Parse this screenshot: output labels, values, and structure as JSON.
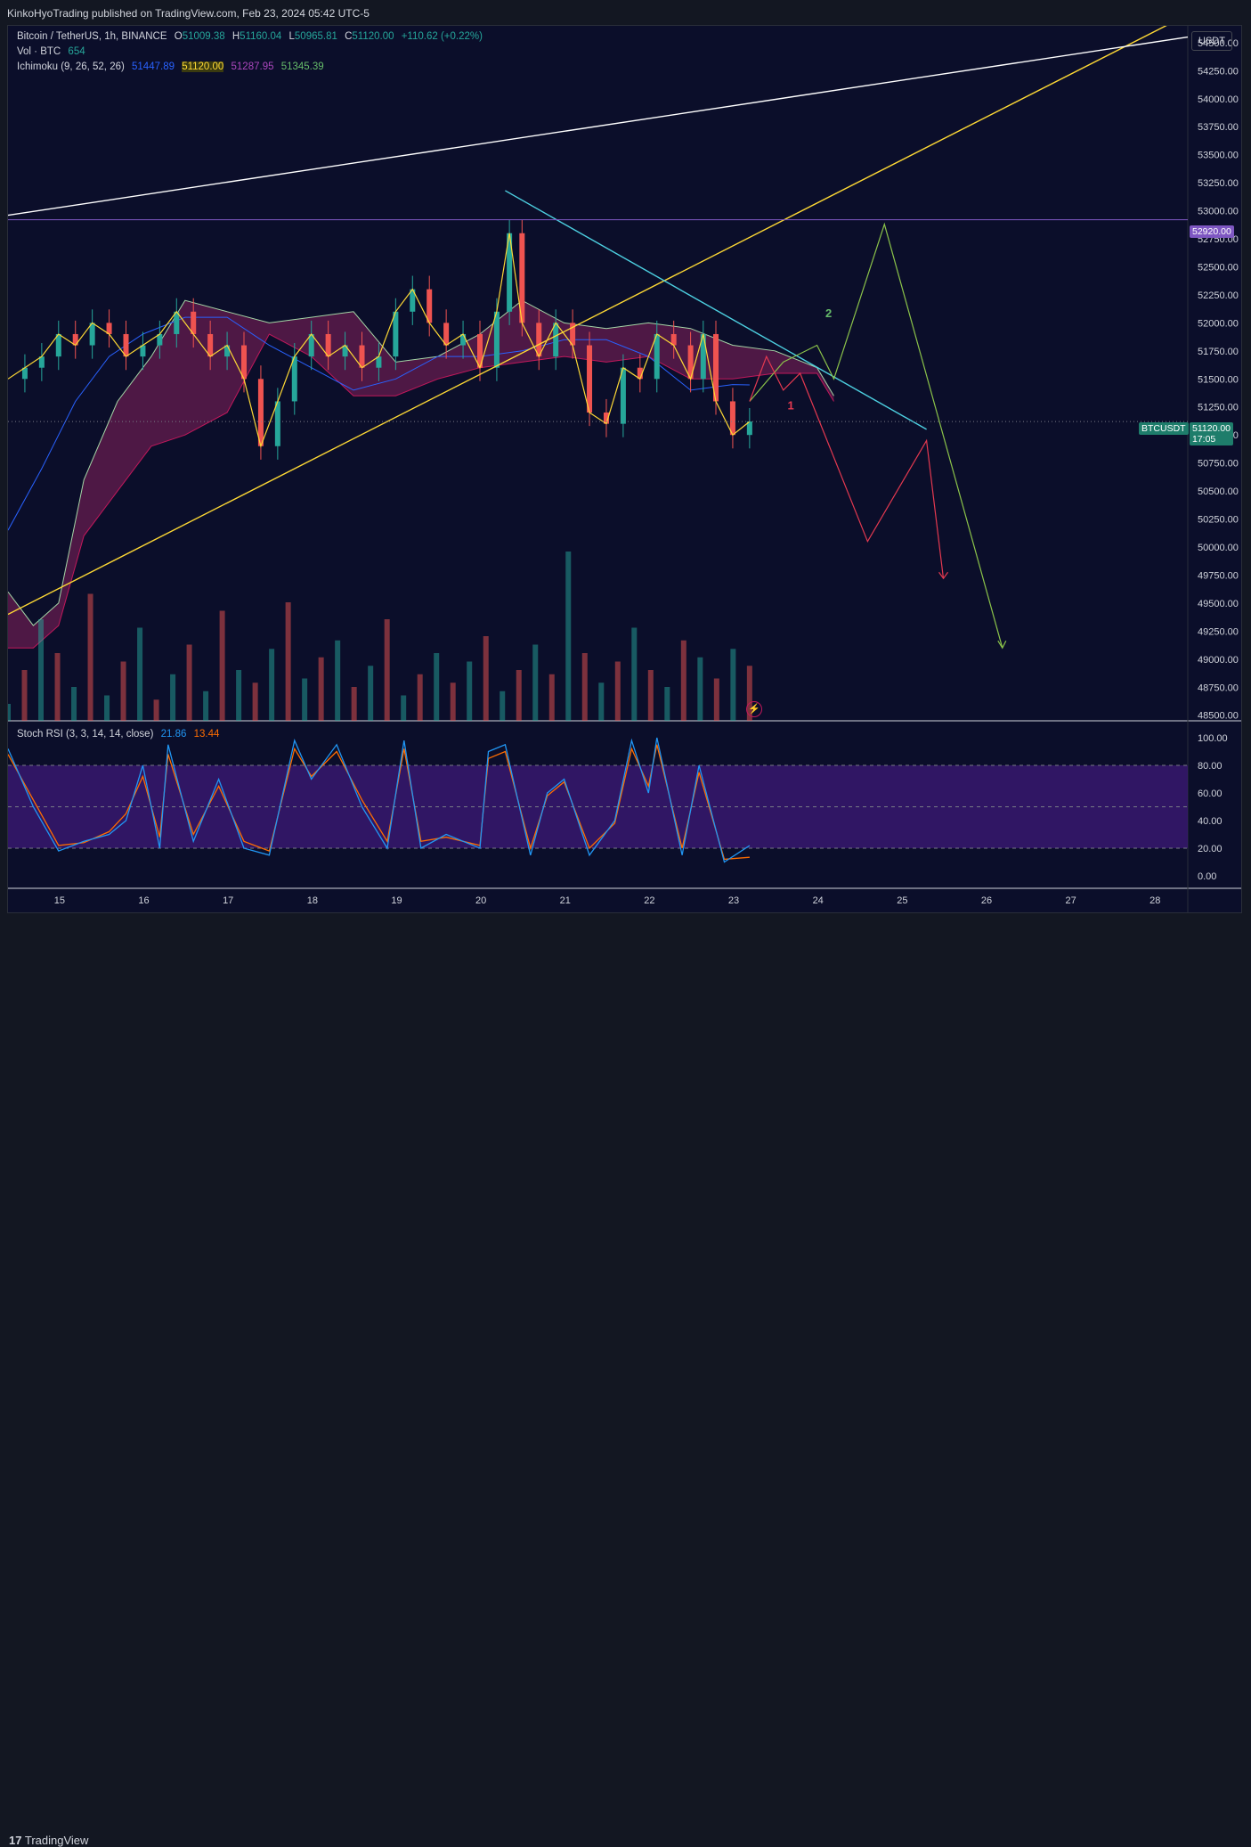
{
  "header": {
    "publisher": "KinkoHyoTrading published on TradingView.com, Feb 23, 2024 05:42 UTC-5"
  },
  "legend": {
    "symbol": "Bitcoin / TetherUS, 1h, BINANCE",
    "open_label": "O",
    "open": "51009.38",
    "high_label": "H",
    "high": "51160.04",
    "low_label": "L",
    "low": "50965.81",
    "close_label": "C",
    "close": "51120.00",
    "change": "+110.62 (+0.22%)",
    "vol_label": "Vol · BTC",
    "vol_value": "654",
    "ichimoku_label": "Ichimoku (9, 26, 52, 26)",
    "ichimoku_values": [
      "51447.89",
      "51120.00",
      "51287.95",
      "51345.39"
    ],
    "stoch_label": "Stoch RSI (3, 3, 14, 14, close)",
    "stoch_k": "21.86",
    "stoch_d": "13.44"
  },
  "price_axis": {
    "currency": "USDT",
    "ticks": [
      "54500.00",
      "54250.00",
      "54000.00",
      "53750.00",
      "53500.00",
      "53250.00",
      "53000.00",
      "52750.00",
      "52500.00",
      "52250.00",
      "52000.00",
      "51750.00",
      "51500.00",
      "51250.00",
      "51000.00",
      "50750.00",
      "50500.00",
      "50250.00",
      "50000.00",
      "49750.00",
      "49500.00",
      "49250.00",
      "49000.00",
      "48750.00",
      "48500.00"
    ],
    "level_tag": "52920.00",
    "symbol_tag": "BTCUSDT",
    "price_tag": "51120.00",
    "countdown": "17:05"
  },
  "rsi_axis": {
    "ticks": [
      "100.00",
      "80.00",
      "60.00",
      "40.00",
      "20.00",
      "0.00"
    ]
  },
  "time_axis": {
    "ticks": [
      "15",
      "16",
      "17",
      "18",
      "19",
      "20",
      "21",
      "22",
      "23",
      "24",
      "25",
      "26",
      "27",
      "28"
    ]
  },
  "annotations": {
    "wave_1": "1",
    "wave_2": "2"
  },
  "footer": {
    "brand": "TradingView"
  },
  "colors": {
    "bull": "#26a69a",
    "bear": "#ef5350",
    "tenkan": "#fdd835",
    "kijun": "#2962ff",
    "cloud_bull": "#2e6b4f",
    "cloud_bear": "#5a1a4a",
    "trend": "#4dd0e1",
    "k": "#2196f3",
    "d": "#ff6d00"
  },
  "chart_data": {
    "type": "candlestick",
    "ylim": [
      48450,
      54650
    ],
    "xlim": [
      14.4,
      28.4
    ],
    "x_ticks": [
      15,
      16,
      17,
      18,
      19,
      20,
      21,
      22,
      23,
      24,
      25,
      26,
      27,
      28
    ],
    "close_series": [
      [
        14.4,
        51500
      ],
      [
        14.6,
        51600
      ],
      [
        14.8,
        51700
      ],
      [
        15.0,
        51900
      ],
      [
        15.2,
        51800
      ],
      [
        15.4,
        52000
      ],
      [
        15.6,
        51900
      ],
      [
        15.8,
        51700
      ],
      [
        16.0,
        51800
      ],
      [
        16.2,
        51900
      ],
      [
        16.4,
        52100
      ],
      [
        16.6,
        51900
      ],
      [
        16.8,
        51700
      ],
      [
        17.0,
        51800
      ],
      [
        17.2,
        51500
      ],
      [
        17.4,
        50900
      ],
      [
        17.6,
        51300
      ],
      [
        17.8,
        51700
      ],
      [
        18.0,
        51900
      ],
      [
        18.2,
        51700
      ],
      [
        18.4,
        51800
      ],
      [
        18.6,
        51600
      ],
      [
        18.8,
        51700
      ],
      [
        19.0,
        52100
      ],
      [
        19.2,
        52300
      ],
      [
        19.4,
        52000
      ],
      [
        19.6,
        51800
      ],
      [
        19.8,
        51900
      ],
      [
        20.0,
        51600
      ],
      [
        20.2,
        52100
      ],
      [
        20.35,
        52800
      ],
      [
        20.5,
        52000
      ],
      [
        20.7,
        51700
      ],
      [
        20.9,
        52000
      ],
      [
        21.1,
        51800
      ],
      [
        21.3,
        51200
      ],
      [
        21.5,
        51100
      ],
      [
        21.7,
        51600
      ],
      [
        21.9,
        51500
      ],
      [
        22.1,
        51900
      ],
      [
        22.3,
        51800
      ],
      [
        22.5,
        51500
      ],
      [
        22.65,
        51900
      ],
      [
        22.8,
        51300
      ],
      [
        23.0,
        51000
      ],
      [
        23.2,
        51120
      ]
    ],
    "ichimoku_cloud": {
      "upper": [
        [
          14.4,
          49600
        ],
        [
          14.7,
          49300
        ],
        [
          15.0,
          49500
        ],
        [
          15.3,
          50600
        ],
        [
          15.7,
          51300
        ],
        [
          16.1,
          51700
        ],
        [
          16.5,
          52200
        ],
        [
          17.0,
          52100
        ],
        [
          17.5,
          52000
        ],
        [
          18.0,
          52050
        ],
        [
          18.5,
          52100
        ],
        [
          19.0,
          51650
        ],
        [
          19.5,
          51700
        ],
        [
          20.0,
          51900
        ],
        [
          20.5,
          52200
        ],
        [
          21.0,
          52000
        ],
        [
          21.5,
          51950
        ],
        [
          22.0,
          52000
        ],
        [
          22.5,
          51950
        ],
        [
          23.0,
          51800
        ],
        [
          23.5,
          51750
        ],
        [
          24.0,
          51600
        ],
        [
          24.2,
          51350
        ]
      ],
      "lower": [
        [
          14.4,
          49100
        ],
        [
          14.7,
          49100
        ],
        [
          15.0,
          49300
        ],
        [
          15.3,
          50100
        ],
        [
          15.7,
          50500
        ],
        [
          16.1,
          50900
        ],
        [
          16.5,
          51000
        ],
        [
          17.0,
          51200
        ],
        [
          17.5,
          51900
        ],
        [
          18.0,
          51700
        ],
        [
          18.5,
          51350
        ],
        [
          19.0,
          51350
        ],
        [
          19.5,
          51500
        ],
        [
          20.0,
          51600
        ],
        [
          20.5,
          51650
        ],
        [
          21.0,
          51700
        ],
        [
          21.5,
          51650
        ],
        [
          22.0,
          51700
        ],
        [
          22.5,
          51500
        ],
        [
          23.0,
          51500
        ],
        [
          23.5,
          51550
        ],
        [
          24.0,
          51550
        ],
        [
          24.2,
          51300
        ]
      ]
    },
    "kijun_series": [
      [
        14.4,
        50150
      ],
      [
        14.8,
        50700
      ],
      [
        15.2,
        51300
      ],
      [
        15.6,
        51700
      ],
      [
        16.0,
        51900
      ],
      [
        16.5,
        52050
      ],
      [
        17.0,
        52050
      ],
      [
        17.5,
        51800
      ],
      [
        18.0,
        51600
      ],
      [
        18.5,
        51400
      ],
      [
        19.0,
        51500
      ],
      [
        19.5,
        51700
      ],
      [
        20.0,
        51700
      ],
      [
        20.5,
        51750
      ],
      [
        21.0,
        51850
      ],
      [
        21.5,
        51850
      ],
      [
        22.0,
        51700
      ],
      [
        22.5,
        51400
      ],
      [
        23.0,
        51450
      ],
      [
        23.2,
        51447
      ]
    ],
    "trend_lines": [
      {
        "from": [
          14.4,
          49400
        ],
        "to": [
          28.4,
          54750
        ],
        "color": "#fdd835"
      },
      {
        "from": [
          14.4,
          52960
        ],
        "to": [
          28.4,
          54550
        ],
        "color": "#ffffff"
      },
      {
        "from": [
          20.3,
          53180
        ],
        "to": [
          25.3,
          51050
        ],
        "color": "#4dd0e1"
      }
    ],
    "level_line": 52920,
    "projection_green": [
      [
        23.2,
        51300
      ],
      [
        23.6,
        51650
      ],
      [
        24.0,
        51800
      ],
      [
        24.2,
        51500
      ],
      [
        24.8,
        52880
      ],
      [
        26.2,
        49100
      ]
    ],
    "projection_red": [
      [
        23.2,
        51300
      ],
      [
        23.4,
        51700
      ],
      [
        23.6,
        51400
      ],
      [
        23.8,
        51550
      ],
      [
        24.6,
        50050
      ],
      [
        25.3,
        50950
      ],
      [
        25.5,
        49720
      ]
    ],
    "volume_values": [
      20,
      60,
      120,
      80,
      40,
      150,
      30,
      70,
      110,
      25,
      55,
      90,
      35,
      130,
      60,
      45,
      85,
      140,
      50,
      75,
      95,
      40,
      65,
      120,
      30,
      55,
      80,
      45,
      70,
      100,
      35,
      60,
      90,
      55,
      200,
      80,
      45,
      70,
      110,
      60,
      40,
      95,
      75,
      50,
      85,
      65
    ],
    "stoch_k": [
      [
        14.4,
        92
      ],
      [
        14.7,
        50
      ],
      [
        15.0,
        18
      ],
      [
        15.3,
        25
      ],
      [
        15.6,
        30
      ],
      [
        15.8,
        40
      ],
      [
        16.0,
        80
      ],
      [
        16.2,
        20
      ],
      [
        16.3,
        95
      ],
      [
        16.6,
        25
      ],
      [
        16.9,
        70
      ],
      [
        17.2,
        20
      ],
      [
        17.5,
        15
      ],
      [
        17.8,
        98
      ],
      [
        18.0,
        70
      ],
      [
        18.3,
        95
      ],
      [
        18.6,
        50
      ],
      [
        18.9,
        20
      ],
      [
        19.1,
        98
      ],
      [
        19.3,
        20
      ],
      [
        19.6,
        30
      ],
      [
        20.0,
        20
      ],
      [
        20.1,
        90
      ],
      [
        20.3,
        95
      ],
      [
        20.6,
        15
      ],
      [
        20.8,
        60
      ],
      [
        21.0,
        70
      ],
      [
        21.3,
        15
      ],
      [
        21.6,
        40
      ],
      [
        21.8,
        98
      ],
      [
        22.0,
        60
      ],
      [
        22.1,
        100
      ],
      [
        22.4,
        15
      ],
      [
        22.6,
        80
      ],
      [
        22.9,
        10
      ],
      [
        23.2,
        21.86
      ]
    ],
    "stoch_d": [
      [
        14.4,
        88
      ],
      [
        14.7,
        55
      ],
      [
        15.0,
        22
      ],
      [
        15.3,
        24
      ],
      [
        15.6,
        32
      ],
      [
        15.8,
        45
      ],
      [
        16.0,
        72
      ],
      [
        16.2,
        28
      ],
      [
        16.3,
        88
      ],
      [
        16.6,
        30
      ],
      [
        16.9,
        65
      ],
      [
        17.2,
        25
      ],
      [
        17.5,
        18
      ],
      [
        17.8,
        92
      ],
      [
        18.0,
        72
      ],
      [
        18.3,
        90
      ],
      [
        18.6,
        55
      ],
      [
        18.9,
        25
      ],
      [
        19.1,
        92
      ],
      [
        19.3,
        25
      ],
      [
        19.6,
        28
      ],
      [
        20.0,
        22
      ],
      [
        20.1,
        85
      ],
      [
        20.3,
        90
      ],
      [
        20.6,
        20
      ],
      [
        20.8,
        58
      ],
      [
        21.0,
        68
      ],
      [
        21.3,
        20
      ],
      [
        21.6,
        38
      ],
      [
        21.8,
        92
      ],
      [
        22.0,
        65
      ],
      [
        22.1,
        95
      ],
      [
        22.4,
        20
      ],
      [
        22.6,
        75
      ],
      [
        22.9,
        12
      ],
      [
        23.2,
        13.44
      ]
    ]
  }
}
